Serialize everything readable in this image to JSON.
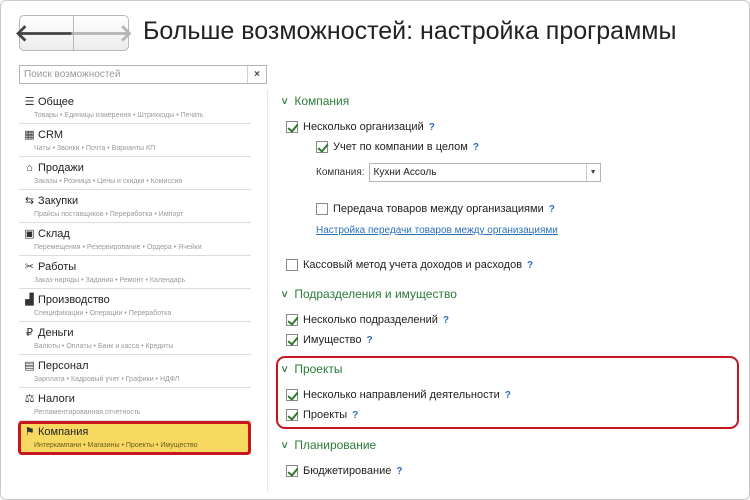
{
  "header": {
    "back_glyph": "🡐",
    "forward_glyph": "🡒",
    "title": "Больше возможностей: настройка программы"
  },
  "search": {
    "placeholder": "Поиск возможностей",
    "clear_glyph": "×"
  },
  "sidebar": {
    "items": [
      {
        "label": "Общее",
        "icon": "list-icon",
        "glyph": "☰",
        "sub": "Товары • Единицы измерения • Штрихкоды • Печать"
      },
      {
        "label": "CRM",
        "icon": "crm-icon",
        "glyph": "▦",
        "sub": "Чаты • Звонки • Почта • Варианты КП"
      },
      {
        "label": "Продажи",
        "icon": "shop-icon",
        "glyph": "⌂",
        "sub": "Заказы • Розница • Цены и скидки • Комиссия"
      },
      {
        "label": "Закупки",
        "icon": "purchase-icon",
        "glyph": "⇆",
        "sub": "Прайсы поставщиков • Переработка • Импорт"
      },
      {
        "label": "Склад",
        "icon": "warehouse-icon",
        "glyph": "▣",
        "sub": "Перемещения • Резервирование • Ордера • Ячейки"
      },
      {
        "label": "Работы",
        "icon": "tools-icon",
        "glyph": "✂",
        "sub": "Заказ-наряды • Задания • Ремонт • Календарь"
      },
      {
        "label": "Производство",
        "icon": "factory-icon",
        "glyph": "▟",
        "sub": "Спецификации • Операции • Переработка"
      },
      {
        "label": "Деньги",
        "icon": "money-icon",
        "glyph": "₽",
        "sub": "Валюты • Оплаты • Банк и касса • Кредиты"
      },
      {
        "label": "Персонал",
        "icon": "staff-icon",
        "glyph": "▤",
        "sub": "Зарплата • Кадровый учет • Графики • НДФЛ"
      },
      {
        "label": "Налоги",
        "icon": "tax-icon",
        "glyph": "⚖",
        "sub": "Регламентированная отчетность"
      },
      {
        "label": "Компания",
        "icon": "flag-icon",
        "glyph": "⚑",
        "sub": "Интеркампани • Магазины • Проекты • Имущество"
      }
    ]
  },
  "main": {
    "sections": {
      "company": "Компания",
      "divisions": "Подразделения и имущество",
      "projects": "Проекты",
      "planning": "Планирование"
    },
    "options": {
      "several_orgs": "Несколько организаций",
      "company_wide": "Учет по компании в целом",
      "company_label": "Компания:",
      "company_value": "Кухни Ассоль",
      "transfer_goods": "Передача товаров между организациями",
      "transfer_link": "Настройка передачи товаров между организациями",
      "cash_method": "Кассовый метод учета доходов и расходов",
      "several_divisions": "Несколько подразделений",
      "property": "Имущество",
      "several_directions": "Несколько направлений деятельности",
      "projects": "Проекты",
      "budgeting": "Бюджетирование"
    },
    "help_glyph": "?",
    "chevron_glyph": "∨",
    "select_arrow_glyph": "▼"
  }
}
